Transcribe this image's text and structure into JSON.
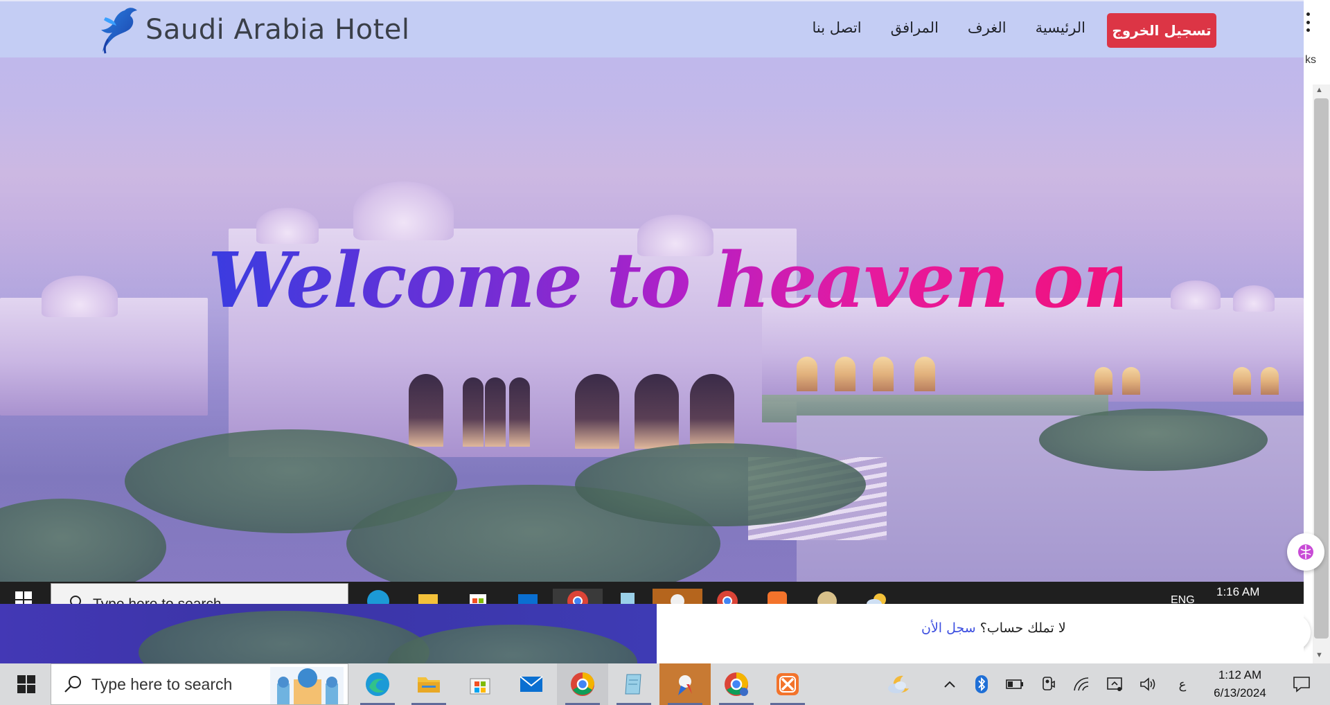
{
  "navbar": {
    "brand": "Saudi Arabia Hotel",
    "links": [
      "الرئيسية",
      "الغرف",
      "المرافق",
      "اتصل بنا"
    ],
    "logout_label": "تسجيل الخروج"
  },
  "hero": {
    "title": "Welcome to heaven on earth"
  },
  "browser": {
    "edge_text": "ks"
  },
  "inner_taskbar": {
    "search_placeholder": "Type here to search",
    "lang": "ENG",
    "time": "1:16 AM"
  },
  "login_prompt": {
    "question": "لا تملك حساب؟",
    "link": "سجل الأن"
  },
  "taskbar": {
    "search_placeholder": "Type here to search",
    "apps": [
      "edge-icon",
      "file-explorer-icon",
      "microsoft-store-icon",
      "mail-icon",
      "chrome-icon",
      "notepad-icon",
      "paint-3d-icon",
      "chrome-profile-icon",
      "xampp-icon"
    ],
    "tray": [
      "weather-icon",
      "chevron-up-icon",
      "bluetooth-icon",
      "battery-icon",
      "camera-icon",
      "wifi-icon",
      "display-icon",
      "volume-icon"
    ],
    "lang_indicator": "ع",
    "time": "1:12 AM",
    "date": "6/13/2024"
  },
  "colors": {
    "logout_button": "#dc3545",
    "title_gradient_start": "#3a3ce0",
    "title_gradient_end": "#f0127d",
    "link": "#3d4fe0"
  }
}
